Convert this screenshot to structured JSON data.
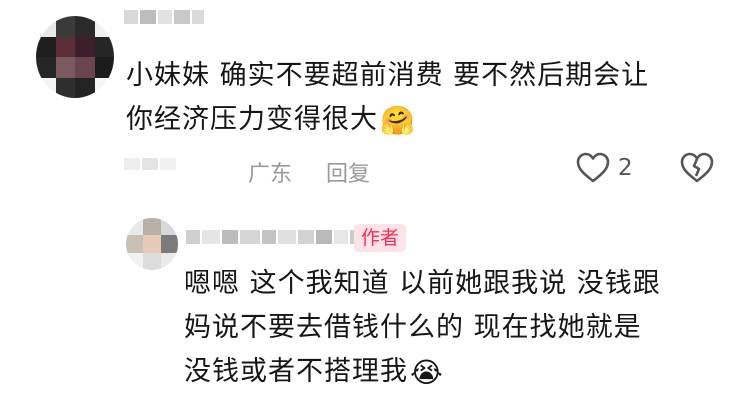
{
  "comments": [
    {
      "text_lines": [
        "小妹妹 确实不要超前消费 要不然后期会让",
        "你经济压力变得很大"
      ],
      "end_emoji": "🤗",
      "location": "广东",
      "reply_label": "回复",
      "like_count": "2"
    },
    {
      "author_badge": "作者",
      "text_lines": [
        "嗯嗯 这个我知道 以前她跟我说 没钱跟",
        "妈说不要去借钱什么的 现在找她就是",
        "没钱或者不搭理我"
      ],
      "end_emoji": "😭"
    }
  ],
  "colors": {
    "author_badge_bg": "#fde3e7",
    "author_badge_text": "#fe2c55",
    "meta_text": "#9a9a9a"
  }
}
